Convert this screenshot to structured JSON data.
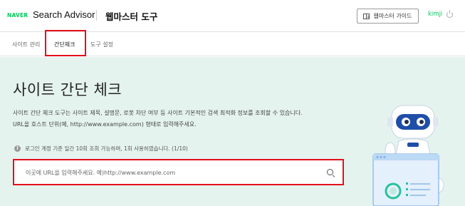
{
  "header": {
    "brand": "NAVER",
    "product": "Search Advisor",
    "section_title": "웹마스터 도구",
    "guide_button": "웹마스터 가이드",
    "user_name": "kimji"
  },
  "tabs": [
    {
      "label": "사이트 관리"
    },
    {
      "label": "간단체크"
    },
    {
      "label": "도구 설정"
    }
  ],
  "main": {
    "title": "사이트 간단 체크",
    "description_line1": "사이트 간단 체크 도구는 사이트 제목, 설명문, 로봇 차단 여부 등 사이트 기본적인 검색 최적화 정보를 조회할 수 있습니다.",
    "description_line2": "URL을 호스트 단위(예, http://www.example.com) 형태로 입력해주세요.",
    "notice": "로그인 계정 기준 일간 10회 조회 가능하며, 1회 사용하였습니다. (1/10)",
    "search_placeholder": "이곳에 URL을 입력해주세요. 예)http://www.example.com"
  },
  "colors": {
    "brand_green": "#03c75a",
    "highlight_red": "#e3101b",
    "main_bg": "#e5f3ef"
  }
}
